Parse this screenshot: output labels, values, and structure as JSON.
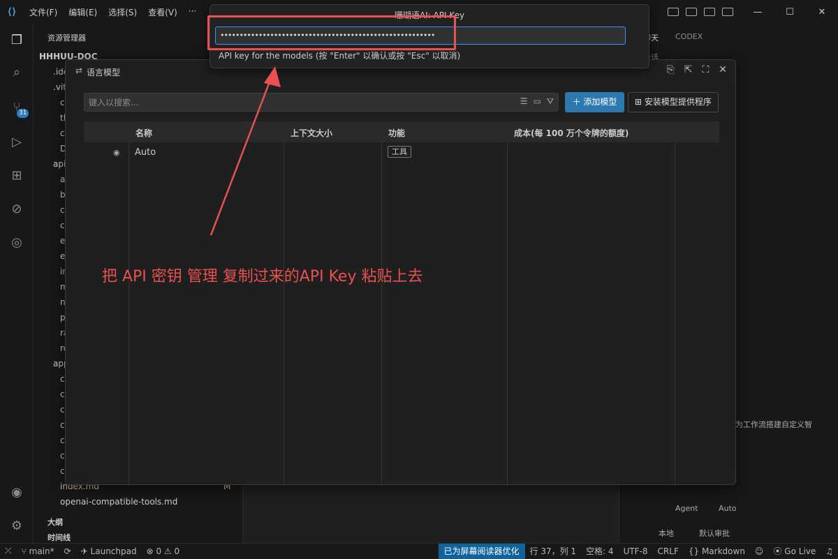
{
  "window": {
    "menu": [
      "文件(F)",
      "编辑(E)",
      "选择(S)",
      "查看(V)",
      "···"
    ],
    "controls": [
      "—",
      "☐",
      "✕"
    ]
  },
  "sidebar": {
    "title": "资源管理器",
    "root": "HHHUU-DOC",
    "rows": [
      ".ide",
      ".vit",
      "ca",
      "th",
      "co",
      "D",
      "api",
      "a",
      "b",
      "cl",
      "cu",
      "e",
      "e",
      "in",
      "m",
      "n",
      "p",
      "ra",
      "re",
      "app",
      "co",
      "co",
      "cl",
      "cl",
      "co",
      "co",
      "co",
      "index.md",
      "openai-compatible-tools.md"
    ],
    "index_badge": "M",
    "sections": [
      "大纲",
      "时间线"
    ]
  },
  "activity": {
    "badge": "31"
  },
  "right_panel": {
    "tabs": [
      "聊天",
      "CODEX"
    ],
    "subtab": "会话",
    "hint_text": "为工作流搭建自定义智",
    "bottom": [
      "Agent",
      "Auto"
    ],
    "footer": [
      "本地",
      "默认审批"
    ]
  },
  "modal": {
    "title": "语言模型",
    "search_placeholder": "键入以搜索...",
    "add_button": "添加模型",
    "install_button": "安装模型提供程序",
    "columns": [
      "名称",
      "上下文大小",
      "功能",
      "成本(每 100 万个令牌的额度)"
    ],
    "rows": [
      {
        "name": "Auto",
        "tag": "工具"
      }
    ]
  },
  "quick_input": {
    "title": "珊瑚语AI: API Key",
    "value": "••••••••••••••••••••••••••••••••••••••••••••••••••••••••",
    "message": "API key for the models (按 \"Enter\" 以确认或按 \"Esc\" 以取消)"
  },
  "annotation": "把 API 密钥 管理 复制过来的API Key 粘贴上去",
  "statusbar": {
    "branch": "main*",
    "launchpad": "Launchpad",
    "errors": "⊗ 0 ⚠ 0",
    "accessibility": "已为屏幕阅读器优化",
    "position": "行 37，列 1",
    "spaces": "空格: 4",
    "encoding": "UTF-8",
    "eol": "CRLF",
    "language": "Markdown",
    "golive": "Go Live"
  }
}
